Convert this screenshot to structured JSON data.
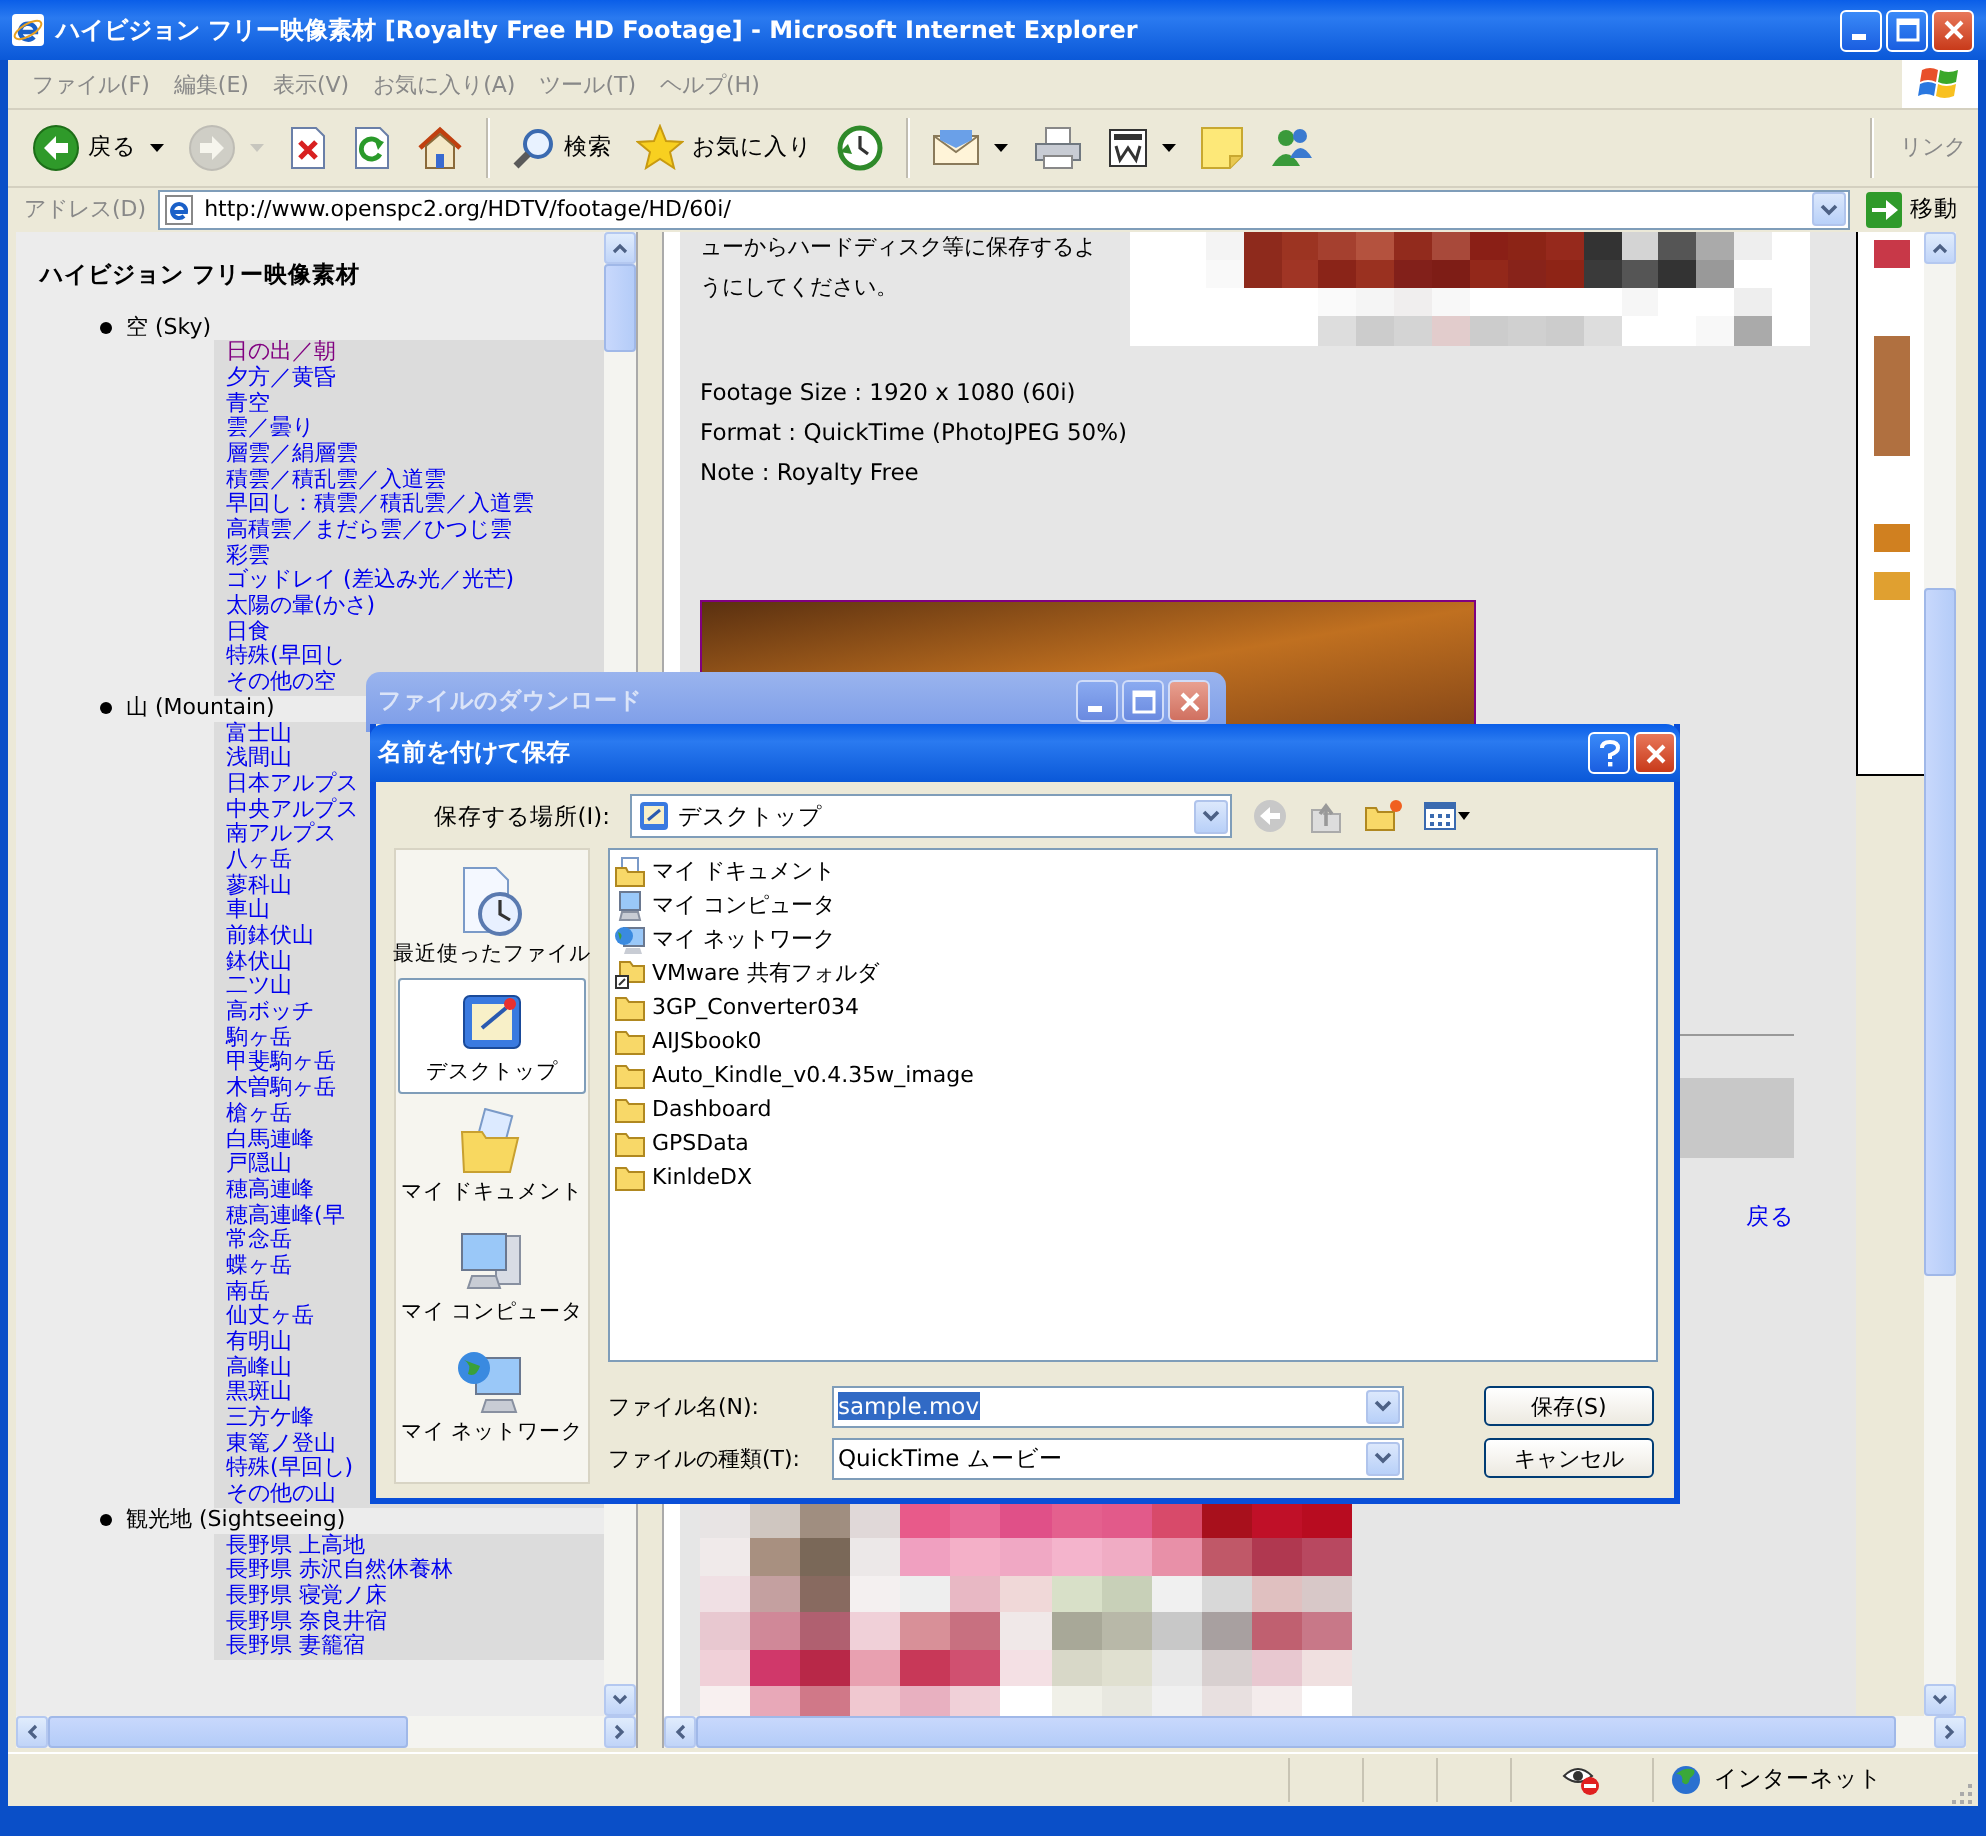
{
  "window": {
    "title": "ハイビジョン フリー映像素材 [Royalty Free HD Footage] - Microsoft Internet Explorer"
  },
  "menu": [
    "ファイル(F)",
    "編集(E)",
    "表示(V)",
    "お気に入り(A)",
    "ツール(T)",
    "ヘルプ(H)"
  ],
  "toolbar": [
    [
      {
        "kind": "back",
        "label": "戻る",
        "dropdown": true,
        "disabled": false
      },
      {
        "kind": "forward",
        "dropdown": true,
        "disabled": true
      },
      {
        "kind": "stop",
        "dropdown": false,
        "disabled": false
      },
      {
        "kind": "refresh",
        "dropdown": false,
        "disabled": false
      },
      {
        "kind": "home",
        "dropdown": false,
        "disabled": false
      }
    ],
    [
      {
        "kind": "search",
        "label": "検索",
        "dropdown": false,
        "disabled": false
      },
      {
        "kind": "favorites",
        "label": "お気に入り",
        "dropdown": false,
        "disabled": false
      },
      {
        "kind": "history",
        "dropdown": false,
        "disabled": false
      }
    ],
    [
      {
        "kind": "mail",
        "dropdown": true,
        "disabled": false
      },
      {
        "kind": "print",
        "dropdown": false,
        "disabled": false
      },
      {
        "kind": "edit",
        "dropdown": true,
        "disabled": false
      },
      {
        "kind": "note",
        "dropdown": false,
        "disabled": false
      },
      {
        "kind": "messenger",
        "dropdown": false,
        "disabled": false
      }
    ]
  ],
  "links_label": "リンク",
  "address": {
    "label": "アドレス(D)",
    "value": "http://www.openspc2.org/HDTV/footage/HD/60i/",
    "go": "移動"
  },
  "left_frame": {
    "heading": "ハイビジョン フリー映像素材",
    "categories": [
      {
        "name": "空 (Sky)",
        "links": [
          {
            "label": "日の出／朝",
            "visited": true
          },
          {
            "label": "夕方／黄昏",
            "visited": false
          },
          {
            "label": "青空",
            "visited": false
          },
          {
            "label": "雲／曇り",
            "visited": false
          },
          {
            "label": "層雲／絹層雲",
            "visited": false
          },
          {
            "label": "積雲／積乱雲／入道雲",
            "visited": false
          },
          {
            "label": "早回し：積雲／積乱雲／入道雲",
            "visited": false
          },
          {
            "label": "高積雲／まだら雲／ひつじ雲",
            "visited": false
          },
          {
            "label": "彩雲",
            "visited": false
          },
          {
            "label": "ゴッドレイ (差込み光／光芒)",
            "visited": false
          },
          {
            "label": "太陽の暈(かさ)",
            "visited": false
          },
          {
            "label": "日食",
            "visited": false
          },
          {
            "label": "特殊(早回し",
            "visited": false
          },
          {
            "label": "その他の空",
            "visited": false
          }
        ]
      },
      {
        "name": "山 (Mountain)",
        "links": [
          {
            "label": "富士山",
            "visited": false
          },
          {
            "label": "浅間山",
            "visited": false
          },
          {
            "label": "日本アルプス",
            "visited": false
          },
          {
            "label": "中央アルプス",
            "visited": false
          },
          {
            "label": "南アルプス",
            "visited": false
          },
          {
            "label": "八ヶ岳",
            "visited": false
          },
          {
            "label": "蓼科山",
            "visited": false
          },
          {
            "label": "車山",
            "visited": false
          },
          {
            "label": "前鉢伏山",
            "visited": false
          },
          {
            "label": "鉢伏山",
            "visited": false
          },
          {
            "label": "二ツ山",
            "visited": false
          },
          {
            "label": "高ボッチ",
            "visited": false
          },
          {
            "label": "駒ヶ岳",
            "visited": false
          },
          {
            "label": "甲斐駒ヶ岳",
            "visited": false
          },
          {
            "label": "木曽駒ヶ岳",
            "visited": false
          },
          {
            "label": "槍ヶ岳",
            "visited": false
          },
          {
            "label": "白馬連峰",
            "visited": false
          },
          {
            "label": "戸隠山",
            "visited": false
          },
          {
            "label": "穂高連峰",
            "visited": false
          },
          {
            "label": "穂高連峰(早",
            "visited": false
          },
          {
            "label": "常念岳",
            "visited": false
          },
          {
            "label": "蝶ヶ岳",
            "visited": false
          },
          {
            "label": "南岳",
            "visited": false
          },
          {
            "label": "仙丈ヶ岳",
            "visited": false
          },
          {
            "label": "有明山",
            "visited": false
          },
          {
            "label": "高峰山",
            "visited": false
          },
          {
            "label": "黒斑山",
            "visited": false
          },
          {
            "label": "三方ケ峰",
            "visited": false
          },
          {
            "label": "東篭ノ登山",
            "visited": false
          },
          {
            "label": "特殊(早回し)",
            "visited": false
          },
          {
            "label": "その他の山",
            "visited": false
          }
        ]
      },
      {
        "name": "観光地 (Sightseeing)",
        "links": [
          {
            "label": "長野県 上高地",
            "visited": false
          },
          {
            "label": "長野県 赤沢自然休養林",
            "visited": false
          },
          {
            "label": "長野県 寝覚ノ床",
            "visited": false
          },
          {
            "label": "長野県 奈良井宿",
            "visited": false
          },
          {
            "label": "長野県 妻籠宿",
            "visited": false
          }
        ]
      }
    ]
  },
  "right_frame": {
    "paragraph_lines": [
      "ューからハードディスク等に保存するよ",
      "うにしてください。"
    ],
    "specs": [
      "Footage Size : 1920 x 1080 (60i)",
      "Format : QuickTime (PhotoJPEG 50%)",
      "Note : Royalty Free"
    ],
    "back_link": "戻る"
  },
  "download_dialog": {
    "title": "ファイルのダウンロード"
  },
  "save_dialog": {
    "title": "名前を付けて保存",
    "location_label": "保存する場所(I):",
    "location_value": "デスクトップ",
    "places": [
      {
        "kind": "recent",
        "label": "最近使ったファイル",
        "selected": false
      },
      {
        "kind": "desktop",
        "label": "デスクトップ",
        "selected": true
      },
      {
        "kind": "documents",
        "label": "マイ ドキュメント",
        "selected": false
      },
      {
        "kind": "computer",
        "label": "マイ コンピュータ",
        "selected": false
      },
      {
        "kind": "network",
        "label": "マイ ネットワーク",
        "selected": false
      }
    ],
    "files": [
      {
        "kind": "documents",
        "name": "マイ ドキュメント"
      },
      {
        "kind": "computer",
        "name": "マイ コンピュータ"
      },
      {
        "kind": "network",
        "name": "マイ ネットワーク"
      },
      {
        "kind": "shared",
        "name": "VMware 共有フォルダ"
      },
      {
        "kind": "folder",
        "name": "3GP_Converter034"
      },
      {
        "kind": "folder",
        "name": "AIJSbook0"
      },
      {
        "kind": "folder",
        "name": "Auto_Kindle_v0.4.35w_image"
      },
      {
        "kind": "folder",
        "name": "Dashboard"
      },
      {
        "kind": "folder",
        "name": "GPSData"
      },
      {
        "kind": "folder",
        "name": "KinldeDX"
      }
    ],
    "filename_label": "ファイル名(N):",
    "filename_value": "sample.mov",
    "filename_selected": true,
    "filetype_label": "ファイルの種類(T):",
    "filetype_value": "QuickTime ムービー",
    "buttons": [
      "保存(S)",
      "キャンセル"
    ]
  },
  "status_bar": {
    "zone": "インターネット"
  }
}
